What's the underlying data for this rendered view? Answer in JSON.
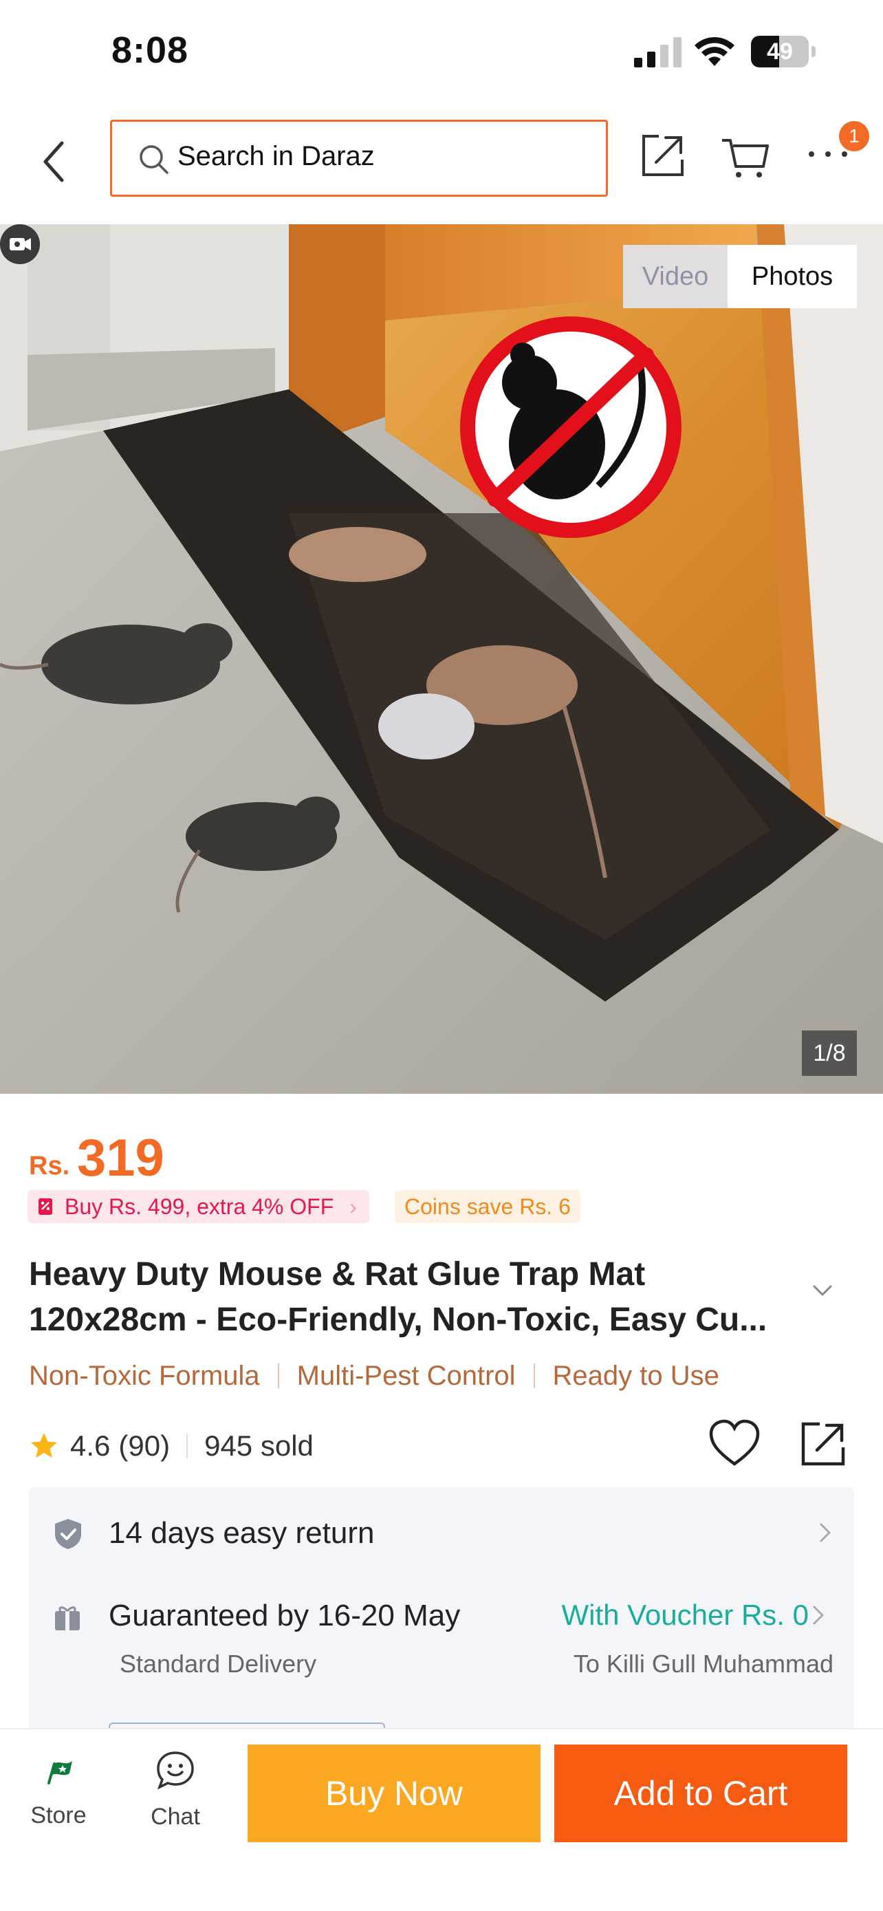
{
  "status_bar": {
    "time": "8:08",
    "battery_percent": 49,
    "battery_label": "49"
  },
  "nav": {
    "search_placeholder": "Search in Daraz",
    "more_badge": "1"
  },
  "gallery": {
    "tab_video": "Video",
    "tab_photos": "Photos",
    "active_tab": "Photos",
    "counter": "1/8"
  },
  "product": {
    "currency": "Rs.",
    "price": "319",
    "promo": "Buy Rs. 499, extra 4% OFF",
    "coins": "Coins save Rs. 6",
    "title_line1": "Heavy Duty Mouse & Rat Glue Trap Mat",
    "title_line2": "120x28cm - Eco-Friendly, Non-Toxic, Easy Cu...",
    "highlights": [
      "Non-Toxic Formula",
      "Multi-Pest Control",
      "Ready to Use"
    ],
    "rating": "4.6",
    "reviews": "(90)",
    "sold": "945 sold"
  },
  "info": {
    "return": "14 days easy return",
    "delivery": "Guaranteed by 16-20 May",
    "delivery_type": "Standard Delivery",
    "voucher": "With Voucher Rs. 0",
    "destination": "To Killi Gull Muhammad"
  },
  "bottom": {
    "store": "Store",
    "chat": "Chat",
    "buy_now": "Buy Now",
    "add_to_cart": "Add to Cart"
  },
  "colors": {
    "brand_orange": "#f36a24",
    "buy_now": "#fca722",
    "add_to_cart": "#f75a11",
    "voucher_teal": "#1aad9c",
    "highlight_brown": "#b5693a"
  }
}
